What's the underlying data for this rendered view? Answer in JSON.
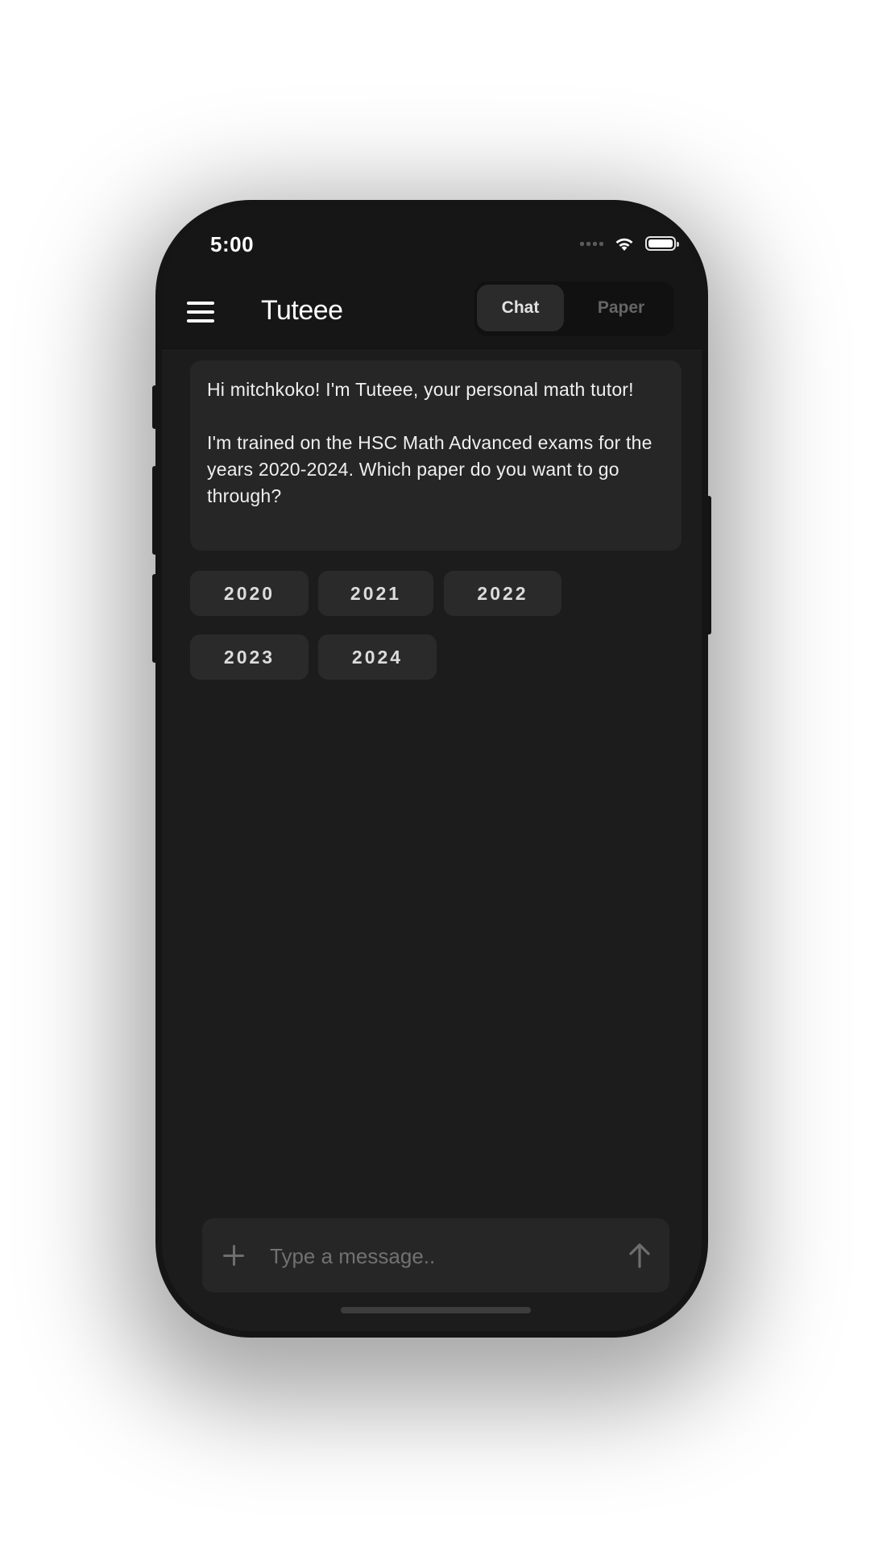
{
  "status_bar": {
    "time": "5:00",
    "icons": [
      "cellular-signal-icon",
      "wifi-icon",
      "battery-icon"
    ]
  },
  "header": {
    "menu_icon": "hamburger-menu-icon",
    "title": "Tuteee",
    "tabs": [
      {
        "label": "Chat",
        "selected": true
      },
      {
        "label": "Paper",
        "selected": false
      }
    ]
  },
  "message": {
    "line1": "Hi mitchkoko! I'm Tuteee, your personal math tutor!",
    "line2": "I'm trained on the HSC Math Advanced exams for the years 2020-2024. Which paper do you want to go through?"
  },
  "year_options": [
    "2020",
    "2021",
    "2022",
    "2023",
    "2024"
  ],
  "composer": {
    "value": "",
    "placeholder": "Type a message..",
    "attach_icon": "plus-icon",
    "send_icon": "arrow-up-icon"
  },
  "colors": {
    "background": "#1c1c1c",
    "header": "#161616",
    "bubble": "#262626",
    "chip": "#2a2a2a",
    "text": "#efefef",
    "muted": "#717171"
  }
}
